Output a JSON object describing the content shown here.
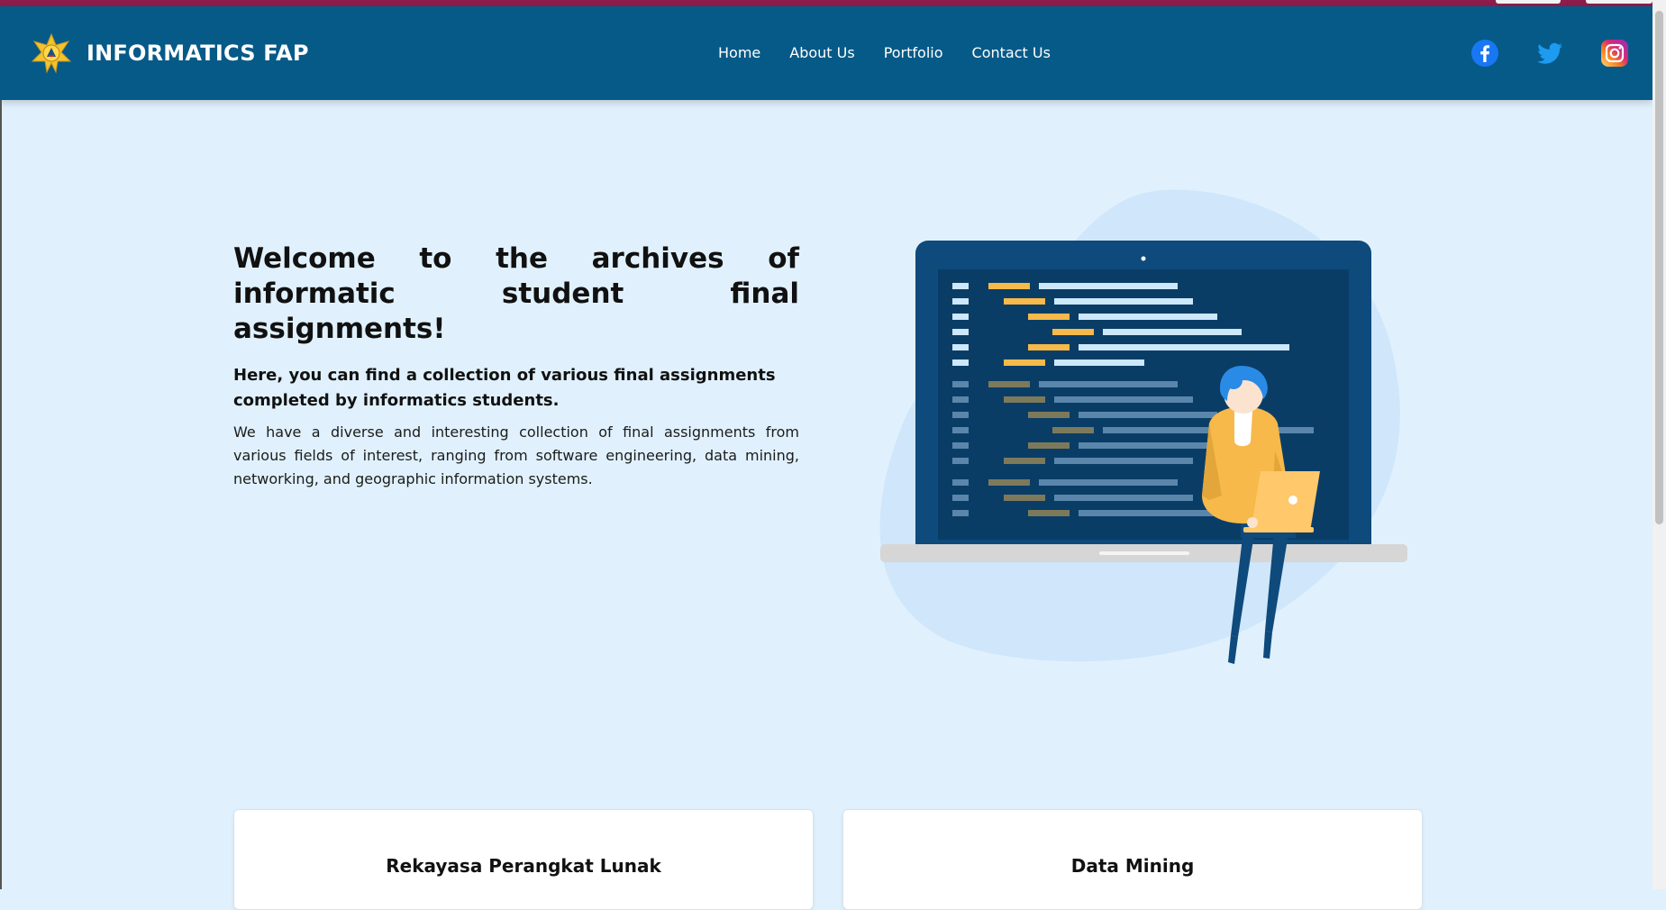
{
  "brand": {
    "name": "INFORMATICS FAP",
    "logo_icon": "university-emblem-icon"
  },
  "nav": {
    "items": [
      {
        "label": "Home"
      },
      {
        "label": "About Us"
      },
      {
        "label": "Portfolio"
      },
      {
        "label": "Contact Us"
      }
    ]
  },
  "socials": [
    {
      "name": "facebook-icon",
      "color": "#1877f2"
    },
    {
      "name": "twitter-icon",
      "color": "#1d9bf0"
    },
    {
      "name": "instagram-icon",
      "color": "#e1306c"
    }
  ],
  "hero": {
    "title": "Welcome to the archives of informatic student final assignments!",
    "subtitle": "Here, you can find a collection of various final assignments completed by informatics students.",
    "description": "We have a diverse and interesting collection of final assignments from various fields of interest, ranging from software engineering, data mining, networking, and geographic information systems."
  },
  "cards": [
    {
      "title": "Rekayasa Perangkat Lunak"
    },
    {
      "title": "Data Mining"
    }
  ],
  "colors": {
    "navbar": "#065a88",
    "background": "#e0f1fd",
    "accent_strip": "#8e1d4b",
    "illustration_yellow": "#f6b94a"
  }
}
